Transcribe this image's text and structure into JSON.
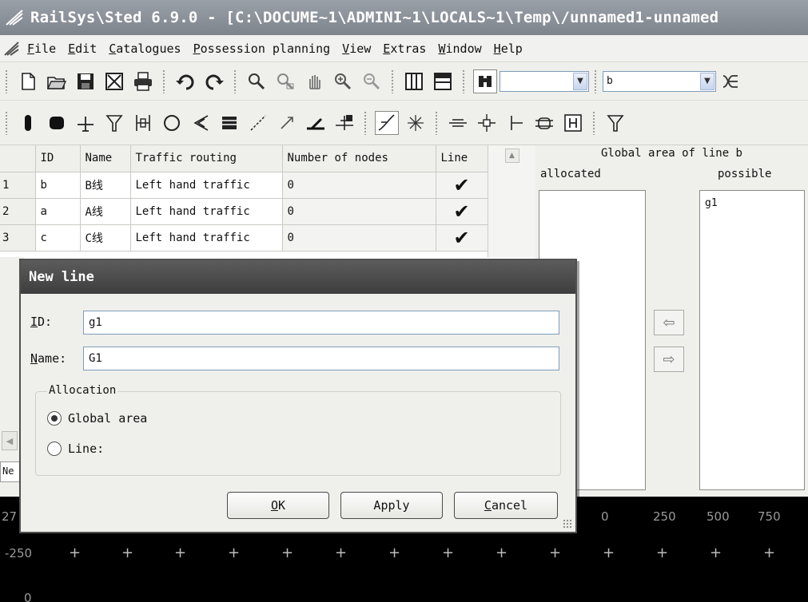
{
  "window": {
    "title": "RailSys\\Sted 6.9.0 - [C:\\DOCUME~1\\ADMINI~1\\LOCALS~1\\Temp\\/unnamed1-unnamed"
  },
  "menu": {
    "items": [
      {
        "underline": "F",
        "rest": "ile"
      },
      {
        "underline": "E",
        "rest": "dit"
      },
      {
        "underline": "C",
        "rest": "atalogues"
      },
      {
        "underline": "P",
        "rest": "ossession planning"
      },
      {
        "underline": "V",
        "rest": "iew"
      },
      {
        "underline": "E",
        "rest": "xtras"
      },
      {
        "underline": "W",
        "rest": "indow"
      },
      {
        "underline": "H",
        "rest": "elp"
      }
    ]
  },
  "toolbar": {
    "combo1_value": "",
    "combo2_value": "b"
  },
  "grid": {
    "columns": [
      "ID",
      "Name",
      "Traffic routing",
      "Number of nodes",
      "Line"
    ],
    "rows": [
      {
        "num": "1",
        "id": "b",
        "name": "B线",
        "routing": "Left hand traffic",
        "nodes": "0",
        "line_checked": true
      },
      {
        "num": "2",
        "id": "a",
        "name": "A线",
        "routing": "Left hand traffic",
        "nodes": "0",
        "line_checked": true
      },
      {
        "num": "3",
        "id": "c",
        "name": "C线",
        "routing": "Left hand traffic",
        "nodes": "0",
        "line_checked": true
      }
    ],
    "check_glyph": "✔"
  },
  "right_panel": {
    "title": "Global area of line b",
    "allocated_label": "allocated",
    "possible_label": "possible",
    "possible_items": [
      "g1"
    ]
  },
  "left_tab": "Ne",
  "canvas": {
    "x_labels": [
      "27",
      "0",
      "250",
      "500",
      "750"
    ],
    "y_labels": [
      "-250",
      "0"
    ]
  },
  "dialog": {
    "title": "New line",
    "id_label_u": "I",
    "id_label_rest": "D:",
    "id_value": "g1",
    "name_label_u": "N",
    "name_label_rest": "ame:",
    "name_value": "G1",
    "allocation_legend": "Allocation",
    "radio_global": "Global area",
    "radio_line": "Line:",
    "selected": "global",
    "ok_u": "O",
    "ok_rest": "K",
    "apply": "Apply",
    "cancel_u": "C",
    "cancel_rest": "ancel"
  }
}
